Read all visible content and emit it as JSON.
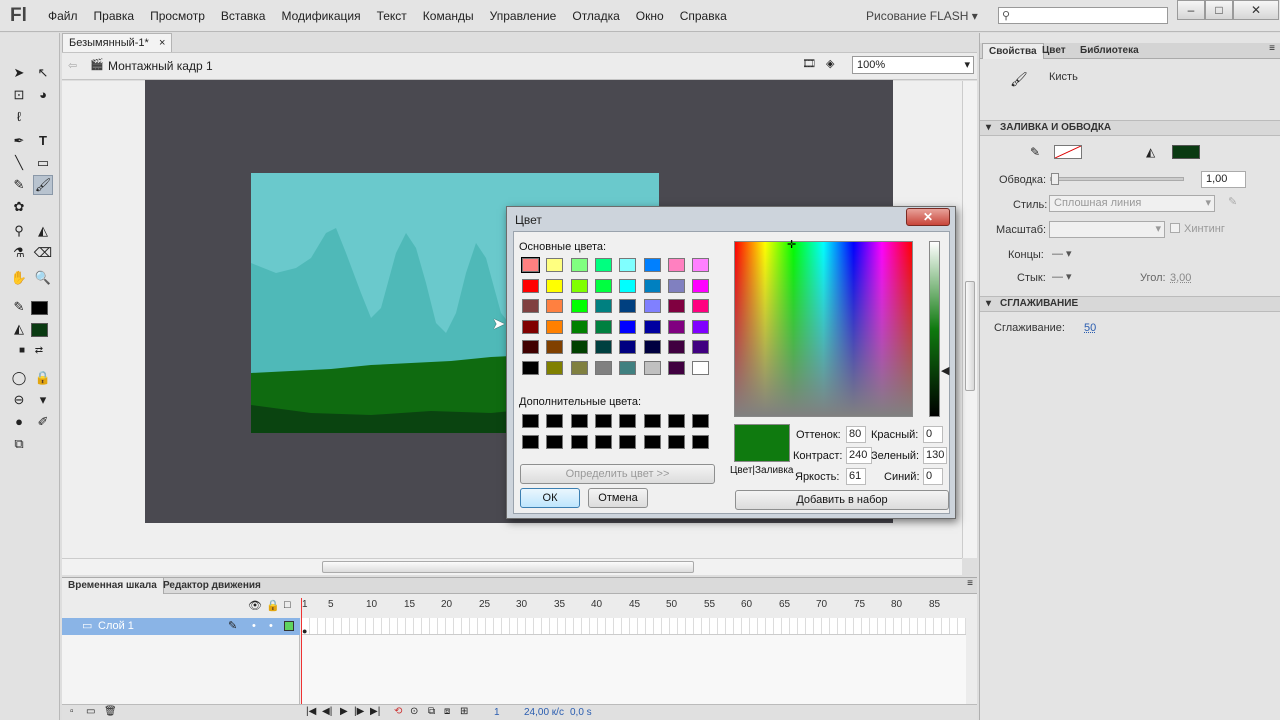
{
  "app": {
    "logo": "Fl",
    "menus": [
      "Файл",
      "Правка",
      "Просмотр",
      "Вставка",
      "Модификация",
      "Текст",
      "Команды",
      "Управление",
      "Отладка",
      "Окно",
      "Справка"
    ],
    "workspace": "Рисование FLASH"
  },
  "window_buttons": [
    "–",
    "□",
    "✕"
  ],
  "document": {
    "tab": "Безымянный-1*",
    "tab_close": "×",
    "scene": "Монтажный кадр 1",
    "zoom": "100%"
  },
  "timeline": {
    "tabs": [
      "Временная шкала",
      "Редактор движения"
    ],
    "layer": "Слой 1",
    "frame_numbers": [
      "1",
      "5",
      "10",
      "15",
      "20",
      "25",
      "30",
      "35",
      "40",
      "45",
      "50",
      "55",
      "60",
      "65",
      "70",
      "75",
      "80",
      "85"
    ],
    "current_frame": "1",
    "fps": "24,00 к/с",
    "time": "0,0 s"
  },
  "panel": {
    "tabs": [
      "Свойства",
      "Цвет",
      "Библиотека"
    ],
    "tool_name": "Кисть",
    "section_fill": "ЗАЛИВКА И ОБВОДКА",
    "stroke_label": "Обводка:",
    "stroke_value": "1,00",
    "style_label": "Стиль:",
    "style_value": "Сплошная линия",
    "scale_label": "Масштаб:",
    "hinting": "Хинтинг",
    "caps_label": "Концы:",
    "joins_label": "Стык:",
    "angle_label": "Угол:",
    "angle_value": "3,00",
    "section_smooth": "СГЛАЖИВАНИЕ",
    "smoothing_label": "Сглаживание:",
    "smoothing_value": "50",
    "fill_color": "#0a3a12"
  },
  "dialog": {
    "title": "Цвет",
    "close": "✕",
    "basic_label": "Основные цвета:",
    "custom_label": "Дополнительные цвета:",
    "define_btn": "Определить цвет >>",
    "ok": "ОК",
    "cancel": "Отмена",
    "add_btn": "Добавить в набор",
    "hue_label": "Оттенок:",
    "hue": "80",
    "sat_label": "Контраст:",
    "sat": "240",
    "lum_label": "Яркость:",
    "lum": "61",
    "red_label": "Красный:",
    "red": "0",
    "green_label": "Зеленый:",
    "green": "130",
    "blue_label": "Синий:",
    "blue": "0",
    "preview_label": "Цвет|Заливка",
    "basic_colors": [
      "#ff8080",
      "#ffff80",
      "#80ff80",
      "#00ff80",
      "#80ffff",
      "#0080ff",
      "#ff80c0",
      "#ff80ff",
      "#ff0000",
      "#ffff00",
      "#80ff00",
      "#00ff40",
      "#00ffff",
      "#0080c0",
      "#8080c0",
      "#ff00ff",
      "#804040",
      "#ff8040",
      "#00ff00",
      "#008080",
      "#004080",
      "#8080ff",
      "#800040",
      "#ff0080",
      "#800000",
      "#ff8000",
      "#008000",
      "#008040",
      "#0000ff",
      "#0000a0",
      "#800080",
      "#8000ff",
      "#400000",
      "#804000",
      "#004000",
      "#004040",
      "#000080",
      "#000040",
      "#400040",
      "#400080",
      "#000000",
      "#808000",
      "#808040",
      "#808080",
      "#408080",
      "#c0c0c0",
      "#400040",
      "#ffffff"
    ],
    "selected_color": "#0f7a0f"
  }
}
